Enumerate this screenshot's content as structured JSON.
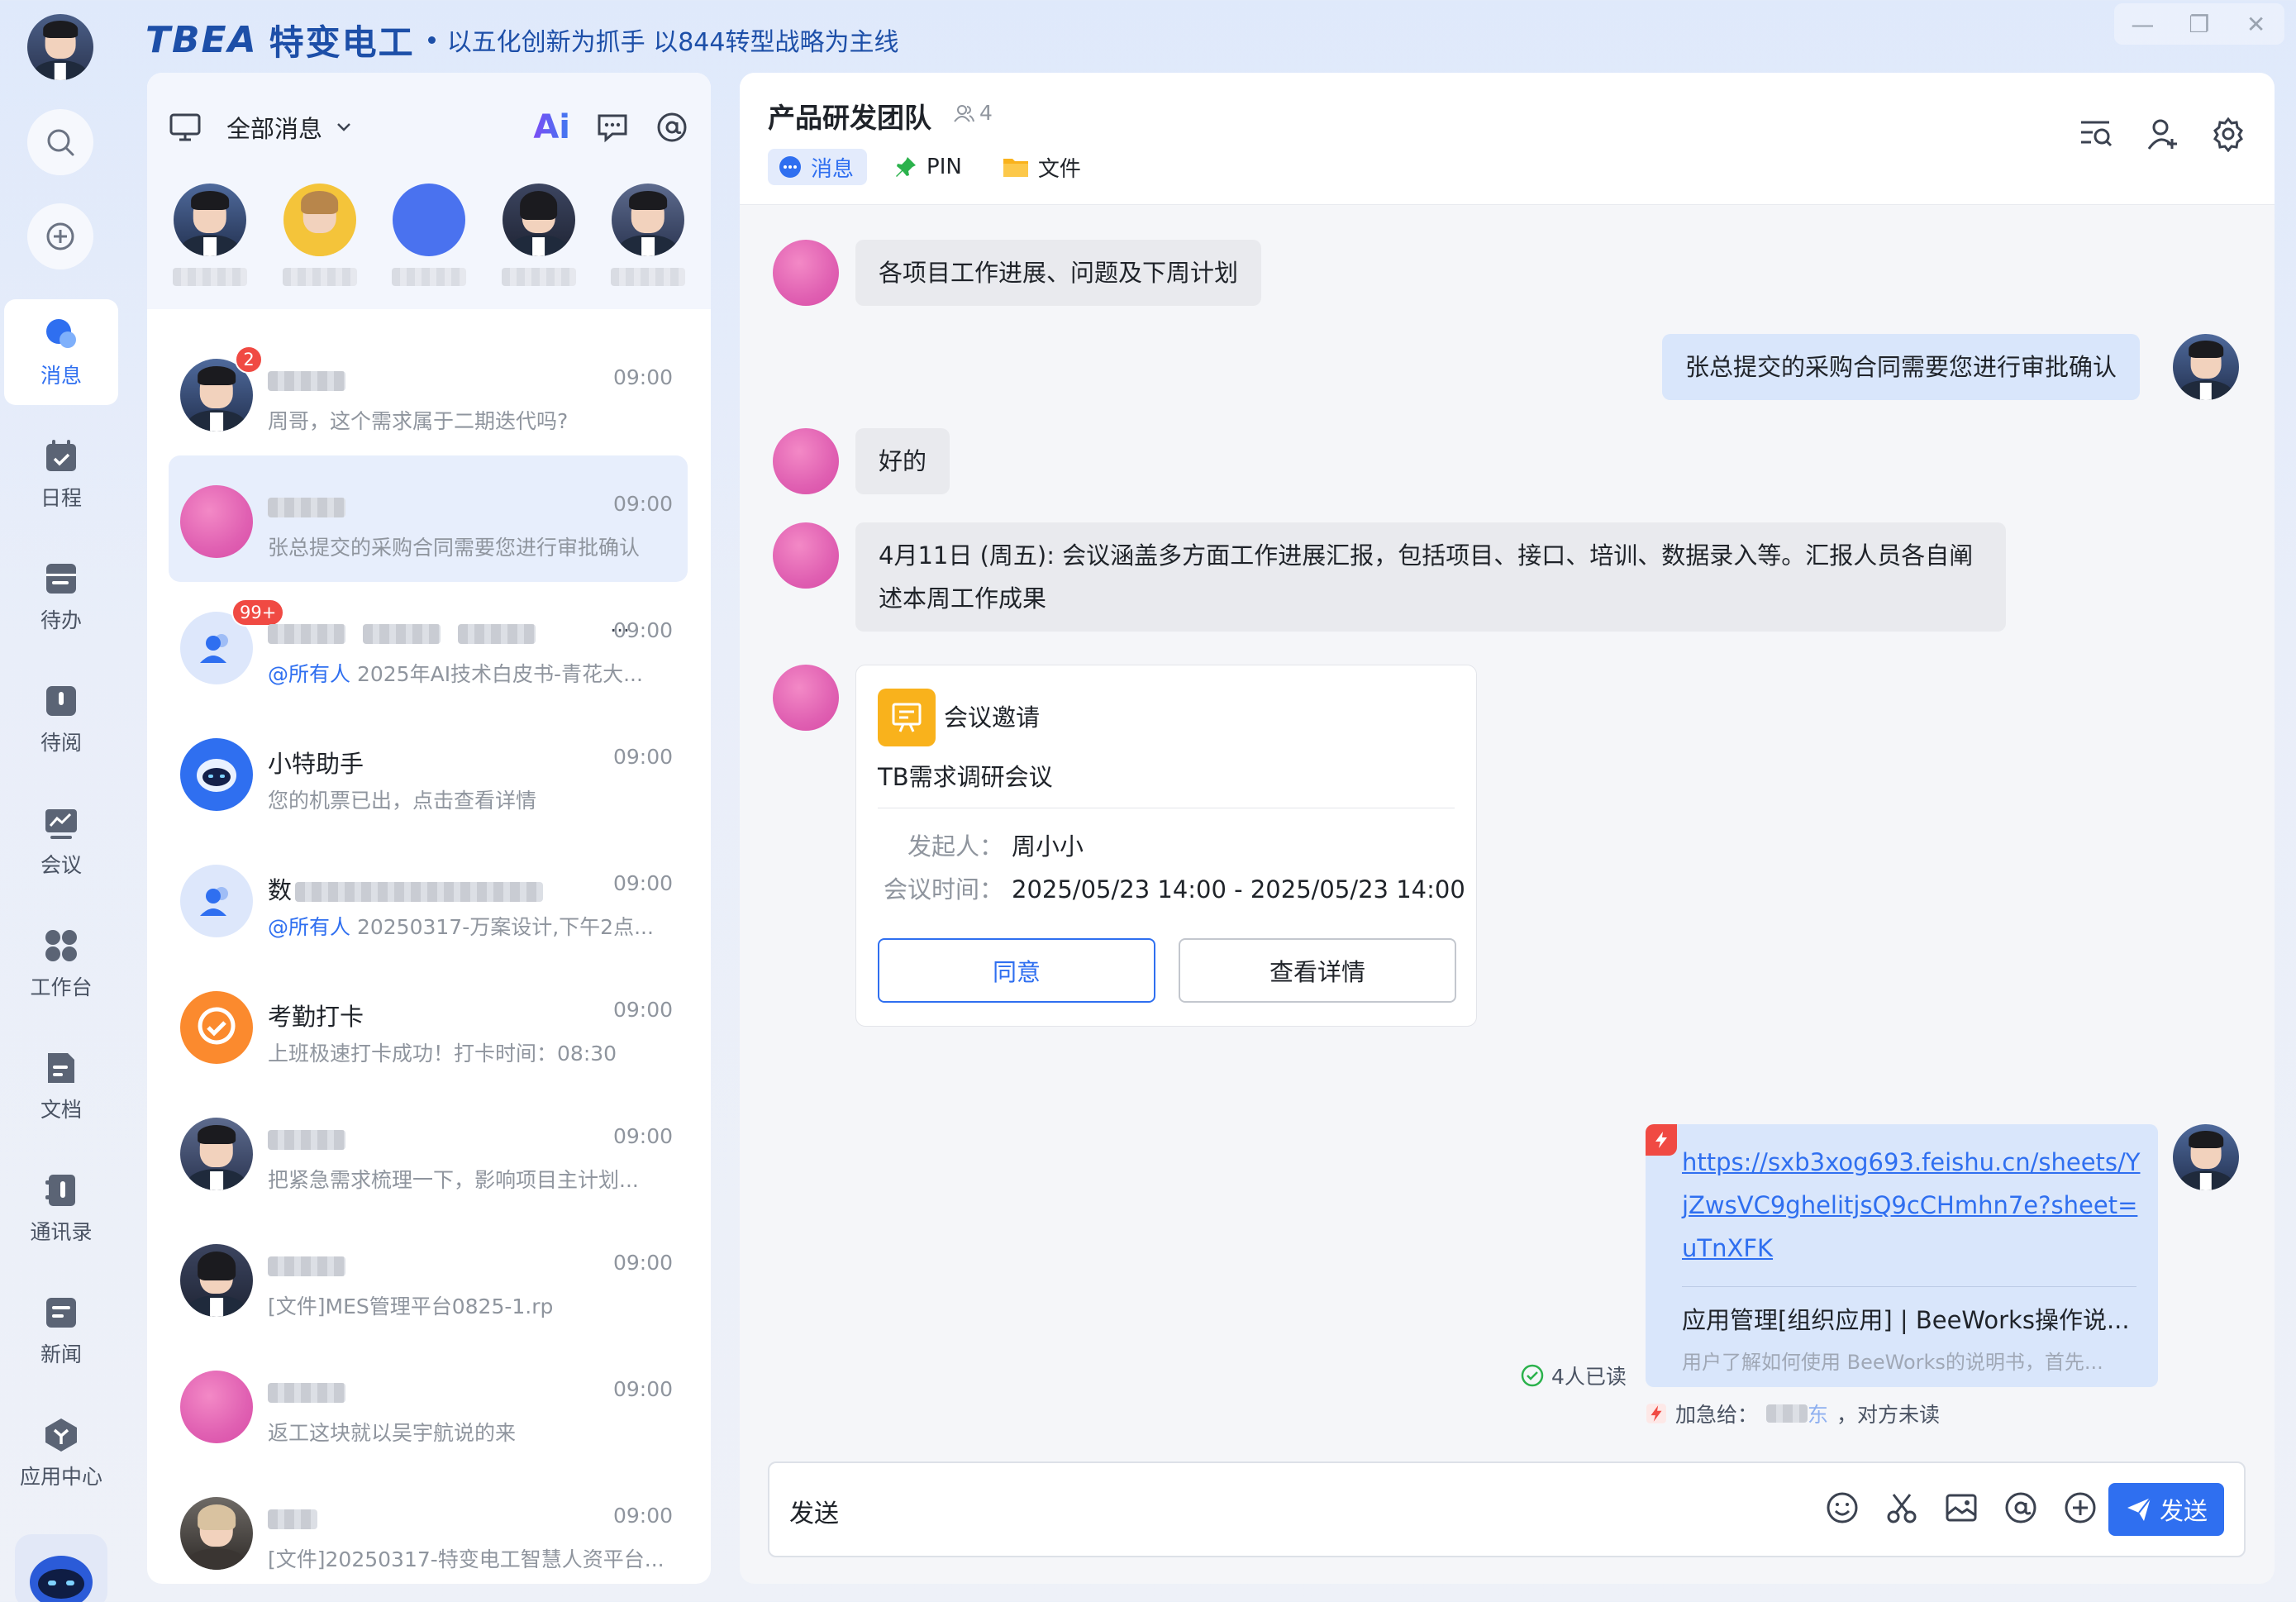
{
  "brand": {
    "logo": "TBEA",
    "name_cn": "特变电工",
    "slogan": "以五化创新为抓手 以844转型战略为主线"
  },
  "window": {
    "minimize": "—",
    "restore": "❐",
    "close": "✕"
  },
  "rail": {
    "items": [
      {
        "label": "消息",
        "icon": "message-icon",
        "active": true
      },
      {
        "label": "日程",
        "icon": "calendar-icon"
      },
      {
        "label": "待办",
        "icon": "todo-icon"
      },
      {
        "label": "待阅",
        "icon": "toread-icon"
      },
      {
        "label": "会议",
        "icon": "meeting-icon"
      },
      {
        "label": "工作台",
        "icon": "workbench-icon"
      },
      {
        "label": "文档",
        "icon": "document-icon"
      },
      {
        "label": "通讯录",
        "icon": "contacts-icon"
      },
      {
        "label": "新闻",
        "icon": "news-icon"
      },
      {
        "label": "应用中心",
        "icon": "app-center-icon"
      }
    ]
  },
  "list": {
    "filter_label": "全部消息",
    "ai_label": "Ai",
    "conversations": [
      {
        "time": "09:00",
        "preview": "周哥，这个需求属于二期迭代吗?",
        "badge": "2"
      },
      {
        "time": "09:00",
        "preview": "张总提交的采购合同需要您进行审批确认"
      },
      {
        "time": "09:00",
        "mention": "@所有人",
        "preview": " 2025年AI技术白皮书-青花大...",
        "badge": "99+",
        "more": "···"
      },
      {
        "name": "小特助手",
        "time": "09:00",
        "preview": "您的机票已出，点击查看详情"
      },
      {
        "name_prefix": "数",
        "time": "09:00",
        "mention": "@所有人",
        "preview": " 20250317-万案设计,下午2点..."
      },
      {
        "name": "考勤打卡",
        "time": "09:00",
        "preview": "上班极速打卡成功！打卡时间：08:30"
      },
      {
        "time": "09:00",
        "preview": "把紧急需求梳理一下，影响项目主计划..."
      },
      {
        "time": "09:00",
        "preview": "[文件]MES管理平台0825-1.rp"
      },
      {
        "time": "09:00",
        "preview": "返工这块就以吴宇航说的来"
      },
      {
        "time": "09:00",
        "preview": "[文件]20250317-特变电工智慧人资平台..."
      }
    ]
  },
  "chat": {
    "title": "产品研发团队",
    "member_count": "4",
    "tabs": [
      {
        "label": "消息",
        "icon": "chat-bubble-icon",
        "active": true
      },
      {
        "label": "PIN",
        "icon": "pin-icon"
      },
      {
        "label": "文件",
        "icon": "folder-icon"
      }
    ],
    "messages": {
      "m1": "各项目工作进展、问题及下周计划",
      "m2": "张总提交的采购合同需要您进行审批确认",
      "m3": "好的",
      "m4": "4月11日 (周五): 会议涵盖多方面工作进展汇报，包括项目、接口、培训、数据录入等。汇报人员各自阐述本周工作成果"
    },
    "meeting_card": {
      "type": "会议邀请",
      "title": "TB需求调研会议",
      "organizer_label": "发起人：",
      "organizer": "周小小",
      "time_label": "会议时间：",
      "time": "2025/05/23  14:00  -  2025/05/23  14:00",
      "accept": "同意",
      "details": "查看详情"
    },
    "link_card": {
      "url": "https://sxb3xog693.feishu.cn/sheets/YjZwsVC9ghelitjsQ9cCHmhn7e?sheet=uTnXFK",
      "title": "应用管理[组织应用] | BeeWorks操作说...",
      "desc": "用户了解如何使用 BeeWorks的说明书，首先..."
    },
    "read_status": "4人已读",
    "urgent_label": "加急给：",
    "urgent_target_tail": "东",
    "urgent_status": "，对方未读",
    "input_value": "发送",
    "send_label": "发送"
  }
}
